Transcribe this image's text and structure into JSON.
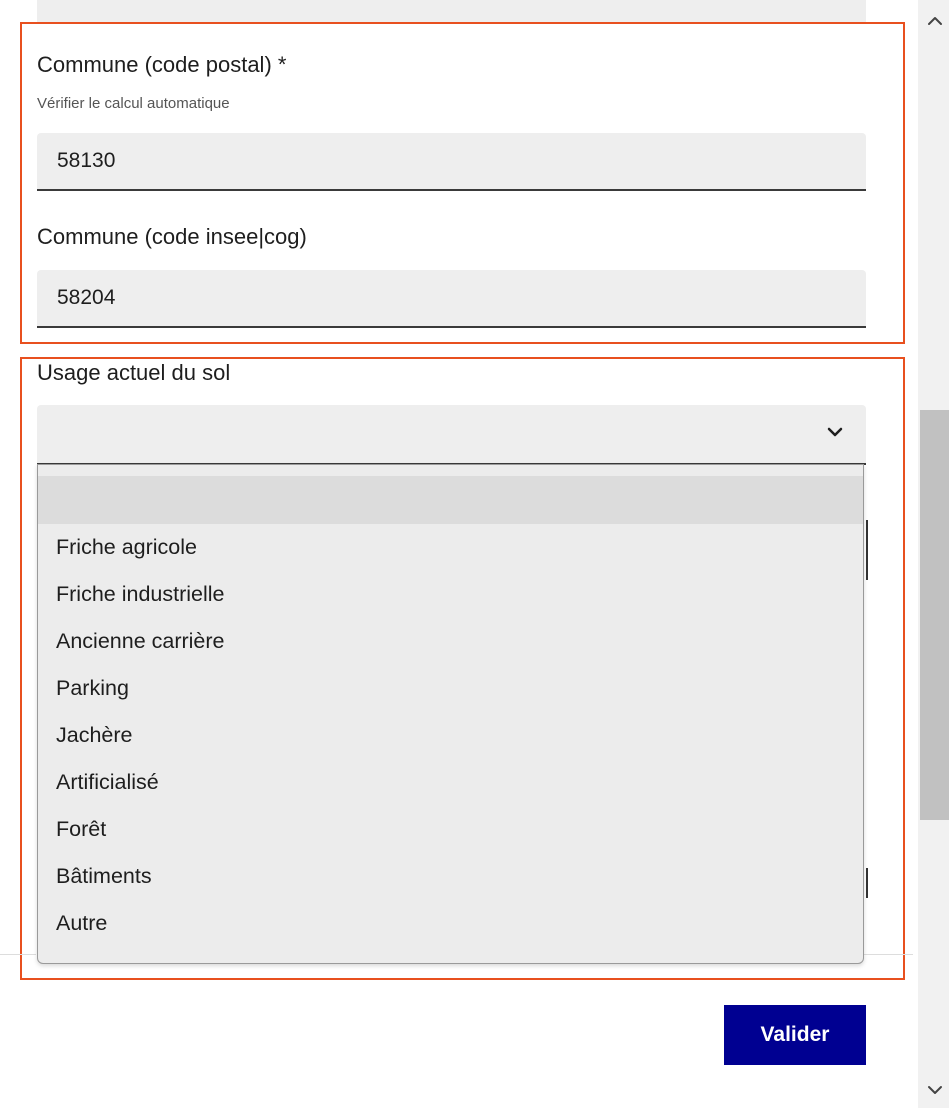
{
  "form": {
    "commune_postal": {
      "label": "Commune (code postal) *",
      "hint": "Vérifier le calcul automatique",
      "value": "58130"
    },
    "commune_insee": {
      "label": "Commune (code insee|cog)",
      "value": "58204"
    },
    "usage_sol": {
      "label": "Usage actuel du sol",
      "selected": "",
      "options": [
        "",
        "Friche agricole",
        "Friche industrielle",
        "Ancienne carrière",
        "Parking",
        "Jachère",
        "Artificialisé",
        "Forêt",
        "Bâtiments",
        "Autre"
      ]
    },
    "submit_label": "Valider"
  },
  "colors": {
    "highlight_border": "#e8501f",
    "input_background": "#eeeeee",
    "button_background": "#000091",
    "button_text": "#ffffff"
  },
  "icons": {
    "select_chevron": "chevron-down-icon",
    "scroll_up": "chevron-up-icon",
    "scroll_down": "chevron-down-icon"
  }
}
